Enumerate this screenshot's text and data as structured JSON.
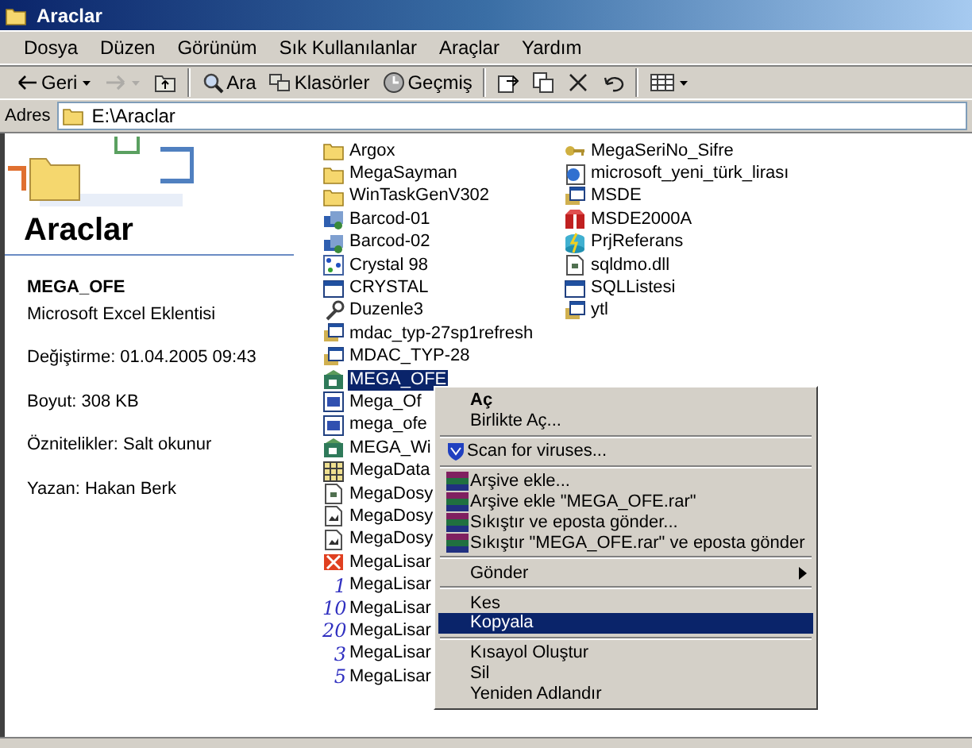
{
  "window": {
    "title": "Araclar"
  },
  "menu": [
    {
      "label": "Dosya"
    },
    {
      "label": "Düzen"
    },
    {
      "label": "Görünüm"
    },
    {
      "label": "Sık Kullanılanlar"
    },
    {
      "label": "Araçlar"
    },
    {
      "label": "Yardım"
    }
  ],
  "toolbar": [
    [
      {
        "kind": "back",
        "label": "Geri",
        "disabled": false,
        "caret": true
      },
      {
        "kind": "forward",
        "disabled": true,
        "caret": true
      },
      {
        "kind": "up",
        "disabled": false,
        "caret": false
      }
    ],
    [
      {
        "kind": "search",
        "label": "Ara",
        "disabled": false,
        "caret": false
      },
      {
        "kind": "folders",
        "label": "Klasörler",
        "disabled": false,
        "caret": false
      },
      {
        "kind": "history",
        "label": "Geçmiş",
        "disabled": false,
        "caret": false
      }
    ],
    [
      {
        "kind": "move",
        "disabled": false,
        "caret": false
      },
      {
        "kind": "copy",
        "disabled": false,
        "caret": false
      },
      {
        "kind": "delete",
        "disabled": false,
        "caret": false
      },
      {
        "kind": "undo",
        "disabled": false,
        "caret": false
      }
    ],
    [
      {
        "kind": "views",
        "disabled": false,
        "caret": true
      }
    ]
  ],
  "address": {
    "label": "Adres",
    "value": "E:\\Araclar"
  },
  "details": {
    "title": "Araclar",
    "file_name": "MEGA_OFE",
    "file_type": "Microsoft Excel Eklentisi",
    "properties": [
      "Değiştirme: 01.04.2005 09:43",
      "Boyut: 308 KB",
      "Öznitelikler: Salt okunur",
      "Yazan: Hakan Berk"
    ]
  },
  "files": [
    [
      {
        "name": "Argox",
        "kind": "folder",
        "selected": false
      },
      {
        "name": "MegaSayman",
        "kind": "folder",
        "selected": false
      },
      {
        "name": "WinTaskGenV302",
        "kind": "folder",
        "selected": false
      },
      {
        "name": "Barcod-01",
        "kind": "program",
        "selected": false
      },
      {
        "name": "Barcod-02",
        "kind": "program",
        "selected": false
      },
      {
        "name": "Crystal 98",
        "kind": "dots",
        "selected": false
      },
      {
        "name": "CRYSTAL",
        "kind": "shortcut",
        "selected": false
      },
      {
        "name": "Duzenle3",
        "kind": "tool",
        "selected": false
      },
      {
        "name": "mdac_typ-27sp1refresh",
        "kind": "installer",
        "selected": false
      },
      {
        "name": "MDAC_TYP-28",
        "kind": "installer",
        "selected": false
      },
      {
        "name": "MEGA_OFE",
        "kind": "excel",
        "selected": true
      },
      {
        "name": "Mega_Of",
        "kind": "word",
        "selected": false
      },
      {
        "name": "mega_ofe",
        "kind": "word",
        "selected": false
      },
      {
        "name": "MEGA_Wi",
        "kind": "excel",
        "selected": false
      },
      {
        "name": "MegaData",
        "kind": "table",
        "selected": false
      },
      {
        "name": "MegaDosy",
        "kind": "document",
        "selected": false
      },
      {
        "name": "MegaDosy",
        "kind": "image",
        "selected": false
      },
      {
        "name": "MegaDosy",
        "kind": "image",
        "selected": false
      },
      {
        "name": "MegaLisar",
        "kind": "error",
        "selected": false
      },
      {
        "name": "MegaLisar",
        "kind": "number",
        "icon_text": "1",
        "selected": false
      },
      {
        "name": "MegaLisar",
        "kind": "number",
        "icon_text": "10",
        "selected": false
      },
      {
        "name": "MegaLisar",
        "kind": "number",
        "icon_text": "20",
        "selected": false
      },
      {
        "name": "MegaLisar",
        "kind": "number",
        "icon_text": "3",
        "selected": false
      },
      {
        "name": "MegaLisar",
        "kind": "number",
        "icon_text": "5",
        "selected": false
      }
    ],
    [
      {
        "name": "MegaSeriNo_Sifre",
        "kind": "key",
        "selected": false
      },
      {
        "name": "microsoft_yeni_türk_lirası",
        "kind": "web",
        "selected": false
      },
      {
        "name": "MSDE",
        "kind": "installer",
        "selected": false
      },
      {
        "name": "MSDE2000A",
        "kind": "package",
        "selected": false
      },
      {
        "name": "PrjReferans",
        "kind": "database",
        "selected": false
      },
      {
        "name": "sqldmo.dll",
        "kind": "document",
        "selected": false
      },
      {
        "name": "SQLListesi",
        "kind": "shortcut",
        "selected": false
      },
      {
        "name": "ytl",
        "kind": "installer",
        "selected": false
      }
    ]
  ],
  "context_menu": [
    {
      "kind": "item",
      "label": "Aç",
      "default": true,
      "selected": false
    },
    {
      "kind": "item",
      "label": "Birlikte Aç...",
      "default": false,
      "selected": false
    },
    {
      "kind": "separator"
    },
    {
      "kind": "shield_item",
      "label": "Scan for viruses...",
      "default": false,
      "selected": false
    },
    {
      "kind": "separator"
    },
    {
      "kind": "archive_item",
      "label": "Arşive ekle...",
      "default": false,
      "selected": false
    },
    {
      "kind": "archive_item",
      "label": "Arşive ekle \"MEGA_OFE.rar\"",
      "default": false,
      "selected": false
    },
    {
      "kind": "archive_item",
      "label": "Sıkıştır ve eposta gönder...",
      "default": false,
      "selected": false
    },
    {
      "kind": "archive_item",
      "label": "Sıkıştır \"MEGA_OFE.rar\" ve eposta gönder",
      "default": false,
      "selected": false
    },
    {
      "kind": "separator"
    },
    {
      "kind": "item",
      "label": "Gönder",
      "submenu": true,
      "default": false,
      "selected": false
    },
    {
      "kind": "separator"
    },
    {
      "kind": "item",
      "label": "Kes",
      "default": false,
      "selected": false
    },
    {
      "kind": "item",
      "label": "Kopyala",
      "default": false,
      "selected": true
    },
    {
      "kind": "separator"
    },
    {
      "kind": "item",
      "label": "Kısayol Oluştur",
      "default": false,
      "selected": false
    },
    {
      "kind": "item",
      "label": "Sil",
      "default": false,
      "selected": false
    },
    {
      "kind": "item",
      "label": "Yeniden Adlandır",
      "default": false,
      "selected": false
    }
  ]
}
